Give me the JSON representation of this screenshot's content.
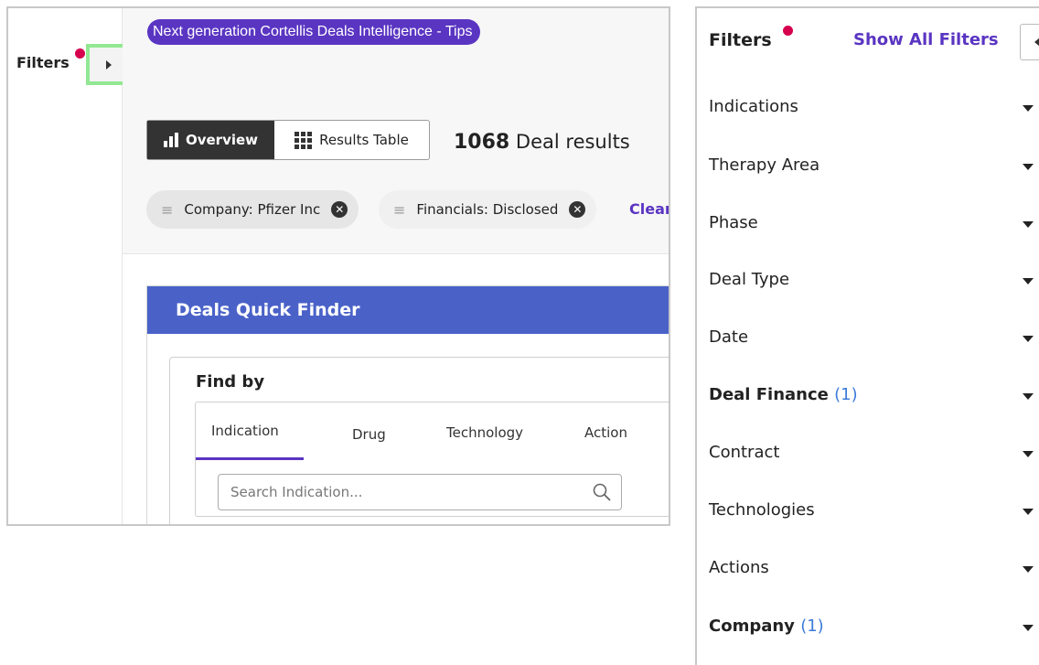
{
  "left": {
    "filters_label": "Filters",
    "tips_banner": "Next generation Cortellis Deals Intelligence - Tips",
    "tab_overview": "Overview",
    "tab_results": "Results Table",
    "results_count": "1068",
    "results_label": "Deal results",
    "chips": [
      "Company: Pfizer Inc",
      "Financials: Disclosed"
    ],
    "clear_label": "Clear",
    "finder_title": "Deals Quick Finder",
    "find_by": "Find by",
    "find_tabs": [
      "Indication",
      "Drug",
      "Technology",
      "Action"
    ],
    "search_placeholder": "Search Indication..."
  },
  "right": {
    "title": "Filters",
    "show_all": "Show All Filters",
    "items": [
      {
        "label": "Indications",
        "count": ""
      },
      {
        "label": "Therapy Area",
        "count": ""
      },
      {
        "label": "Phase",
        "count": ""
      },
      {
        "label": "Deal Type",
        "count": ""
      },
      {
        "label": "Date",
        "count": ""
      },
      {
        "label": "Deal Finance",
        "count": "(1)"
      },
      {
        "label": "Contract",
        "count": ""
      },
      {
        "label": "Technologies",
        "count": ""
      },
      {
        "label": "Actions",
        "count": ""
      },
      {
        "label": "Company",
        "count": "(1)"
      }
    ]
  },
  "colors": {
    "accent": "#5a35c2",
    "notification_dot": "#d6004f",
    "finder_header": "#4a62c8",
    "count_blue": "#3d7bd8"
  }
}
